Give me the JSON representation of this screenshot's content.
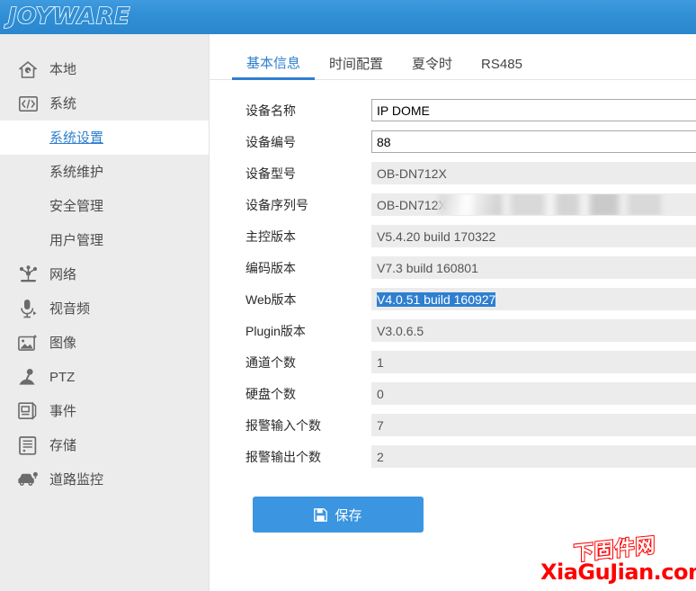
{
  "header": {
    "brand": "JOYWARE"
  },
  "sidebar": {
    "items": [
      {
        "label": "本地",
        "icon": "home-icon",
        "type": "top"
      },
      {
        "label": "系统",
        "icon": "code-brackets-icon",
        "type": "top"
      },
      {
        "label": "系统设置",
        "type": "sub",
        "active": true
      },
      {
        "label": "系统维护",
        "type": "sub",
        "active": false
      },
      {
        "label": "安全管理",
        "type": "sub",
        "active": false
      },
      {
        "label": "用户管理",
        "type": "sub",
        "active": false
      },
      {
        "label": "网络",
        "icon": "network-icon",
        "type": "top"
      },
      {
        "label": "视音频",
        "icon": "microphone-icon",
        "type": "top"
      },
      {
        "label": "图像",
        "icon": "image-icon",
        "type": "top"
      },
      {
        "label": "PTZ",
        "icon": "joystick-icon",
        "type": "top"
      },
      {
        "label": "事件",
        "icon": "event-document-icon",
        "type": "top"
      },
      {
        "label": "存储",
        "icon": "storage-icon",
        "type": "top"
      },
      {
        "label": "道路监控",
        "icon": "car-monitor-icon",
        "type": "top"
      }
    ]
  },
  "tabs": [
    {
      "label": "基本信息",
      "active": true
    },
    {
      "label": "时间配置",
      "active": false
    },
    {
      "label": "夏令时",
      "active": false
    },
    {
      "label": "RS485",
      "active": false
    }
  ],
  "form": {
    "rows": [
      {
        "label": "设备名称",
        "value": "IP DOME",
        "editable": true,
        "selected": false,
        "redacted": false
      },
      {
        "label": "设备编号",
        "value": "88",
        "editable": true,
        "selected": false,
        "redacted": false
      },
      {
        "label": "设备型号",
        "value": "OB-DN712X",
        "editable": false,
        "selected": false,
        "redacted": false
      },
      {
        "label": "设备序列号",
        "value": "OB-DN712X",
        "editable": false,
        "selected": false,
        "redacted": true
      },
      {
        "label": "主控版本",
        "value": "V5.4.20 build 170322",
        "editable": false,
        "selected": false,
        "redacted": false
      },
      {
        "label": "编码版本",
        "value": "V7.3 build 160801",
        "editable": false,
        "selected": false,
        "redacted": false
      },
      {
        "label": "Web版本",
        "value": "V4.0.51 build 160927",
        "editable": false,
        "selected": true,
        "redacted": false
      },
      {
        "label": "Plugin版本",
        "value": "V3.0.6.5",
        "editable": false,
        "selected": false,
        "redacted": false
      },
      {
        "label": "通道个数",
        "value": "1",
        "editable": false,
        "selected": false,
        "redacted": false
      },
      {
        "label": "硬盘个数",
        "value": "0",
        "editable": false,
        "selected": false,
        "redacted": false
      },
      {
        "label": "报警输入个数",
        "value": "7",
        "editable": false,
        "selected": false,
        "redacted": false
      },
      {
        "label": "报警输出个数",
        "value": "2",
        "editable": false,
        "selected": false,
        "redacted": false
      }
    ],
    "save_label": "保存",
    "save_icon": "floppy-disk-icon"
  },
  "watermark": {
    "chinese": "下固件网",
    "domain": "XiaGuJian.com"
  },
  "colors": {
    "brand_blue": "#2f8ed4",
    "accent_blue": "#2f7fd0",
    "button_blue": "#3b95e0",
    "sidebar_bg": "#ececec",
    "selection_blue": "#2f7fd0",
    "watermark_red": "#ff0000"
  }
}
